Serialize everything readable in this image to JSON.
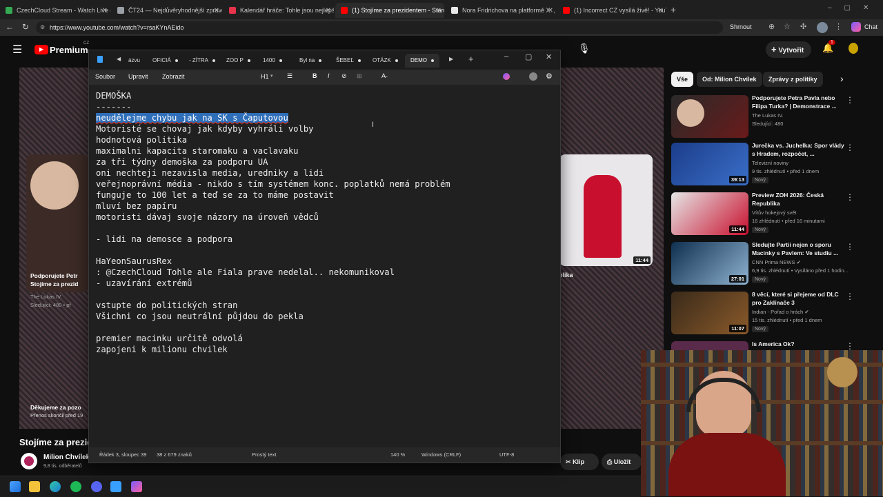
{
  "browser": {
    "tabs": [
      {
        "label": "CzechCloud Stream - Watch Live o",
        "color": "#34a853"
      },
      {
        "label": "ČT24 — Nejdůvěryhodnější zpravo",
        "color": "#9aa0a6"
      },
      {
        "label": "Kalendář hráče: Tohle jsou nejlepš",
        "color": "#e8334a"
      },
      {
        "label": "(1) Stojíme za prezidentem - Staro",
        "color": "#ff0000"
      },
      {
        "label": "Nora Fridrichova na platformě X: ,",
        "color": "#e8e8e8"
      },
      {
        "label": "(1) Incorrect CZ vysílá živě! - YouT",
        "color": "#ff0000"
      }
    ],
    "url": "https://www.youtube.com/watch?v=rsaKYnAEido",
    "summary_label": "Shrnout",
    "chat_label": "Chat"
  },
  "youtube": {
    "logo": "Premium",
    "logo_sup": "CZ",
    "create_label": "Vytvořit",
    "notif_count": "1",
    "left_card_title": "Podporujete Petr",
    "left_card_title2": "Stojíme za prezid",
    "left_card_channel": "The Lukas IV.",
    "left_card_meta": "Sledující: 480 • př",
    "bottom_card_title": "Děkujeme za pozo",
    "bottom_card_meta": "Přenos skončil před 19",
    "video_title": "Stojíme za prezid",
    "channel_name": "Milion Chvílek",
    "subscribers": "9,8 tis. odběratelů",
    "clip_label": "Klip",
    "save_label": "Uložit",
    "thumb_duration": "11:44",
    "side_text": "olika"
  },
  "chips": [
    {
      "label": "Vše",
      "active": true
    },
    {
      "label": "Od: Milion Chvílek",
      "active": false
    },
    {
      "label": "Zprávy z politiky",
      "active": false
    }
  ],
  "recommendations": [
    {
      "title": "Podporujete Petra Pavla nebo Filipa Turka? | Demonstrace ...",
      "channel": "The Lukas IV.",
      "meta": "Sledující: 480",
      "duration": "",
      "badge": ""
    },
    {
      "title": "Jurečka vs. Juchelka: Spor vlády s Hradem, rozpočet, ...",
      "channel": "Televizní noviny",
      "meta": "9 tis. zhlédnutí • před 1 dnem",
      "duration": "39:13",
      "badge": "Nový"
    },
    {
      "title": "Preview ZOH 2026: Česká Republika",
      "channel": "Vítův hokejový svět",
      "meta": "16 zhlédnutí • před 16 minutami",
      "duration": "11:44",
      "badge": "Nový"
    },
    {
      "title": "Sledujte Partii nejen o sporu Macinky s Pavlem: Ve studiu ...",
      "channel": "CNN Prima NEWS",
      "meta": "6,9 tis. zhlédnutí • Vysíláno před 1 hodin...",
      "duration": "27:01",
      "badge": "Nový"
    },
    {
      "title": "8 věcí, které si přejeme od DLC pro Zaklínače 3",
      "channel": "Indian - Pořad o hrách",
      "meta": "15 tis. zhlédnutí • před 1 dnem",
      "duration": "11:07",
      "badge": "Nový"
    },
    {
      "title": "Is America Ok?",
      "channel": "",
      "meta": "",
      "duration": "",
      "badge": ""
    }
  ],
  "notepad": {
    "tabs": [
      "ázvu",
      "OFICIÁ",
      "- ZÍTRA",
      "ZOO P",
      "1400",
      "Byl na",
      "ŠEBEĽ",
      "OTÁZK",
      "DEMO"
    ],
    "menu": [
      "Soubor",
      "Upravit",
      "Zobrazit"
    ],
    "heading_label": "H1",
    "lines": [
      "DEMOŠKA",
      "-------",
      "neudělejme chybu jak na SK s Čaputovou",
      "Motoristé se chovaj jak kdyby vyhráli volby",
      "hodnotová politika",
      "maximalni kapacita staromaku a vaclavaku",
      "za tři týdny demoška za podporu UA",
      "oni nechteji nezavisla media, uredniky a lidi",
      "veřejnoprávní média - nikdo s tím systémem konc. poplatků nemá problém",
      "funguje to 100 let a teď se za to máme postavit",
      "mluví bez papíru",
      "motoristi dávaj svoje názory na úroveň vědců",
      "",
      "- lidi na demosce a podpora",
      "",
      "HaYeonSaurusRex",
      ": @CzechCloud Tohle ale Fiala prave nedelal.. nekomunikoval",
      "- uzavírání extrémů",
      "",
      "vstupte do politických stran",
      "Všichni co jsou neutrální půjdou do pekla",
      "",
      "premier macinku určitě odvolá",
      "zapojeni k milionu chvilek"
    ],
    "status": {
      "position": "Řádek 3, sloupec 39",
      "chars": "38 z 679 znaků",
      "format": "Prostý text",
      "zoom": "140 %",
      "line_endings": "Windows (CRLF)",
      "encoding": "UTF-8"
    }
  }
}
